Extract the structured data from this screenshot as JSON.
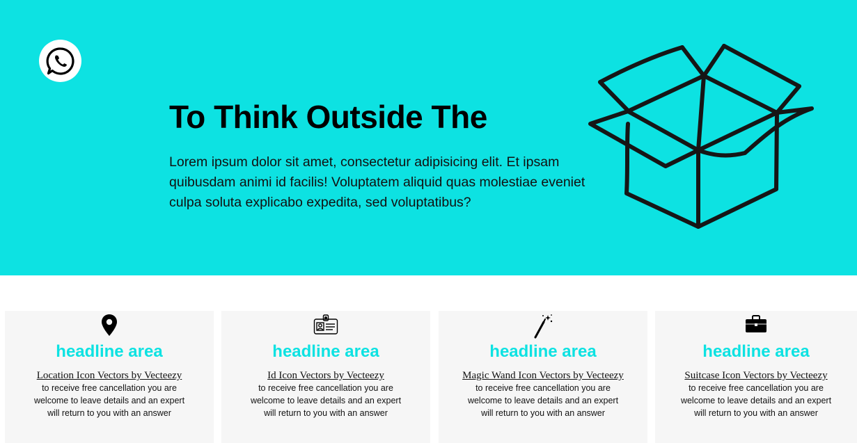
{
  "hero": {
    "title": "To Think Outside The",
    "text": "Lorem ipsum dolor sit amet, consectetur adipisicing elit. Et ipsam quibusdam animi id facilis! Voluptatem aliquid quas molestiae eveniet culpa soluta explicabo expedita, sed voluptatibus?",
    "whatsapp_icon": "whatsapp-icon",
    "illustration": "open-box"
  },
  "colors": {
    "accent": "#0de2e2",
    "card_bg": "#f6f6f6",
    "text": "#111111"
  },
  "cards": [
    {
      "icon": "location-pin-icon",
      "title": "headline area",
      "link": "Location Icon Vectors by Vecteezy",
      "text": "to receive free cancellation you are welcome to leave details and an expert will return to you with an answer"
    },
    {
      "icon": "id-card-icon",
      "title": "headline area",
      "link": "Id Icon Vectors by Vecteezy",
      "text": "to receive free cancellation you are welcome to leave details and an expert will return to you with an answer"
    },
    {
      "icon": "magic-wand-icon",
      "title": "headline area",
      "link": "Magic Wand Icon Vectors by Vecteezy",
      "text": "to receive free cancellation you are welcome to leave details and an expert will return to you with an answer"
    },
    {
      "icon": "suitcase-icon",
      "title": "headline area",
      "link": "Suitcase Icon Vectors by Vecteezy",
      "text": "to receive free cancellation you are welcome to leave details and an expert will return to you with an answer"
    }
  ]
}
